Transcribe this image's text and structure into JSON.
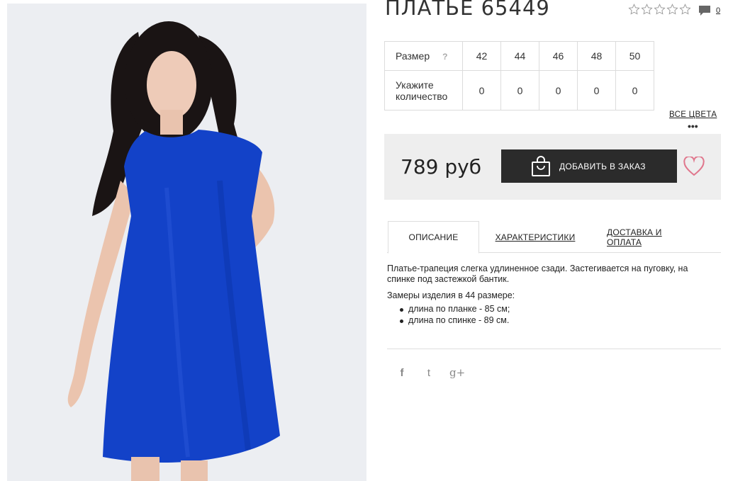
{
  "product": {
    "title": "ПЛАТЬЕ 65449",
    "rating_stars": 5,
    "comment_count": "0",
    "price": "789 руб"
  },
  "sizes": {
    "size_label": "Размер",
    "help": "?",
    "qty_label_1": "Укажите",
    "qty_label_2": "количество",
    "values": [
      "42",
      "44",
      "46",
      "48",
      "50"
    ],
    "quantities": [
      "0",
      "0",
      "0",
      "0",
      "0"
    ]
  },
  "links": {
    "all_colors": "ВСЕ ЦВЕТА",
    "more": "•••"
  },
  "buy": {
    "add_button_label": "ДОБАВИТЬ В ЗАКАЗ"
  },
  "tabs": [
    {
      "label": "ОПИСАНИЕ",
      "active": true
    },
    {
      "label": "ХАРАКТЕРИСТИКИ",
      "active": false
    },
    {
      "label": "ДОСТАВКА И ОПЛАТА",
      "active": false
    }
  ],
  "description": {
    "text": "Платье-трапеция слегка удлиненное сзади. Застегивается на пуговку, на спинке под застежкой бантик.",
    "measure_title": "Замеры изделия в 44 размере:",
    "measures": [
      "длина по планке - 85 см;",
      "длина по спинке - 89 см."
    ]
  },
  "social": {
    "facebook": "f",
    "twitter": "t",
    "googleplus": "g+"
  },
  "colors": {
    "dress": "#1342c8",
    "button_bg": "#2b2b2b",
    "panel_bg": "#eeeeee",
    "heart": "#e0768c",
    "photo_bg": "#eceef2"
  },
  "icons": [
    "star-icon",
    "comment-icon",
    "shopping-bag-icon",
    "heart-icon",
    "facebook-icon",
    "twitter-icon",
    "google-plus-icon"
  ]
}
